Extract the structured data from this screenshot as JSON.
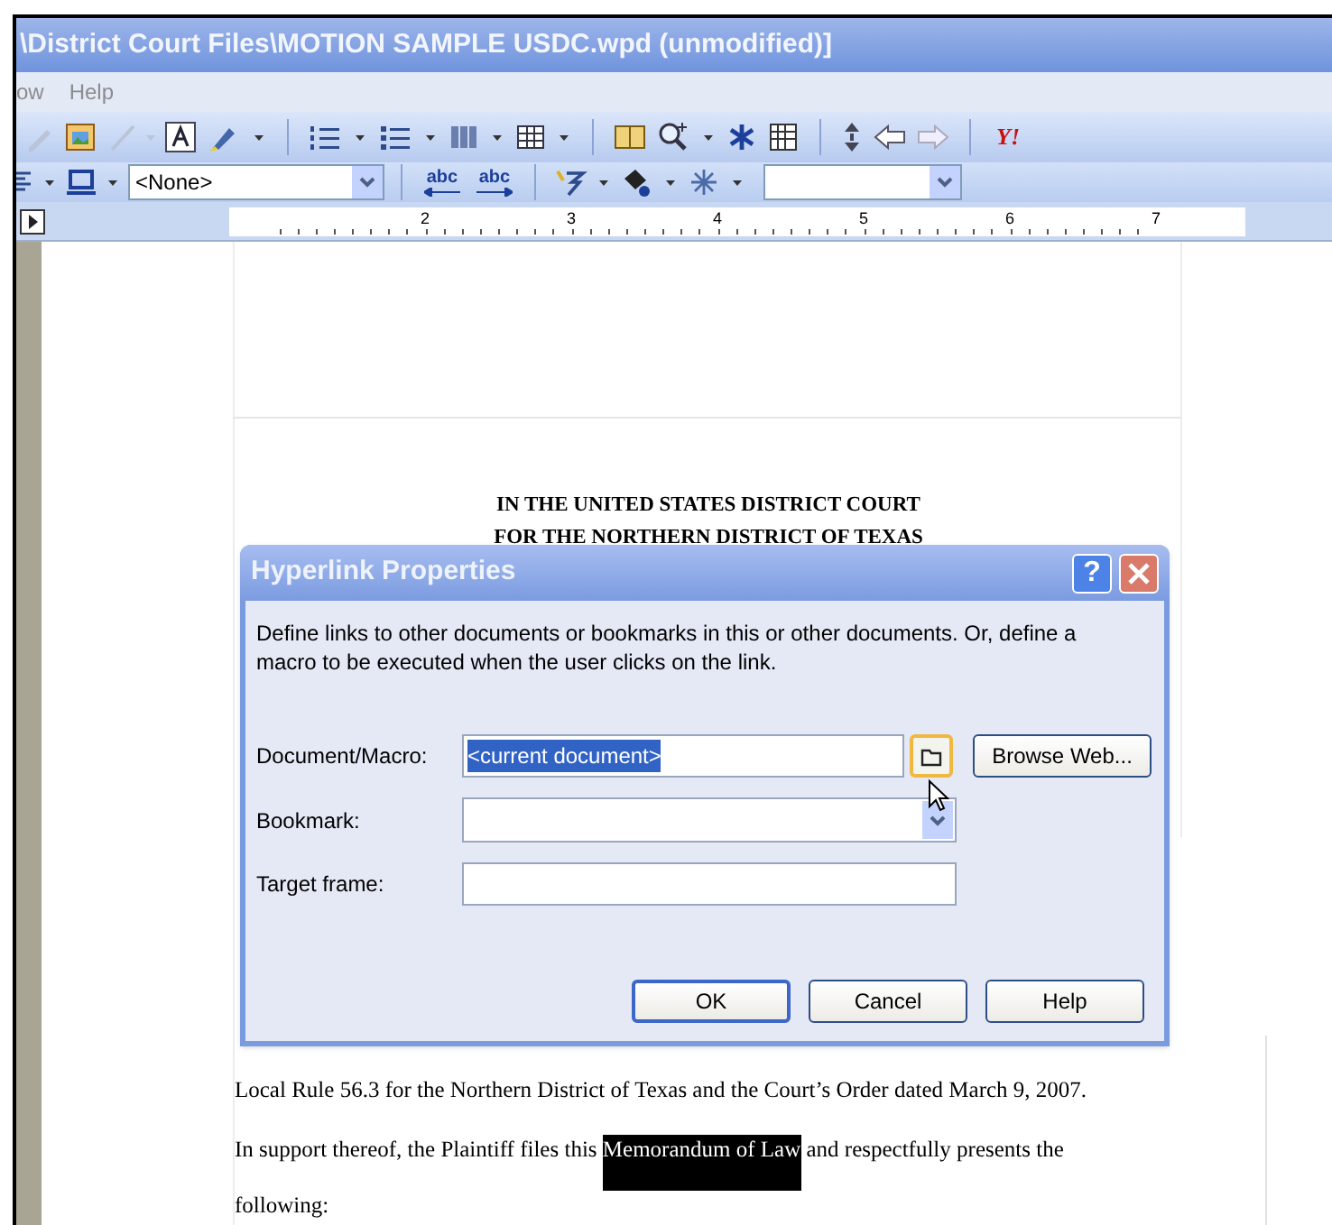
{
  "window": {
    "title": "\\District Court Files\\MOTION SAMPLE USDC.wpd (unmodified)]"
  },
  "menu": [
    "ow",
    "Help"
  ],
  "toolbar": {
    "logo_text": "Y!"
  },
  "format_bar": {
    "style_value": "<None>",
    "spell_buttons": [
      "abc",
      "abc"
    ]
  },
  "ruler": {
    "labels": [
      "2",
      "3",
      "4",
      "5",
      "6",
      "7"
    ]
  },
  "document": {
    "heading": [
      "IN THE UNITED STATES DISTRICT COURT",
      "FOR THE NORTHERN DISTRICT OF TEXAS"
    ],
    "paragraphs": [
      [
        {
          "text": "Local Rule 56.3 for the Northern District of Texas and the Court’s Order dated March 9, 2007.",
          "selected": false
        }
      ],
      [
        {
          "text": "In support thereof, the Plaintiff files this ",
          "selected": false
        },
        {
          "text": "Memorandum of Law",
          "selected": true
        },
        {
          "text": " and respectfully presents the",
          "selected": false
        }
      ],
      [
        {
          "text": "following:",
          "selected": false
        }
      ]
    ]
  },
  "dialog": {
    "title": "Hyperlink Properties",
    "help_button": "?",
    "description": "Define links to other documents or bookmarks in this or other documents. Or, define a macro to be executed when the user clicks on the link.",
    "fields": [
      {
        "kind": "text",
        "label": "Document/Macro:",
        "value": "<current document>",
        "value_selected": true
      },
      {
        "kind": "dropdown",
        "label": "Bookmark:"
      },
      {
        "kind": "text",
        "label": "Target frame:"
      }
    ],
    "browse_button": "Browse Web...",
    "buttons": [
      {
        "label": "OK",
        "default": true
      },
      {
        "label": "Cancel",
        "default": false
      },
      {
        "label": "Help",
        "default": false
      }
    ]
  }
}
